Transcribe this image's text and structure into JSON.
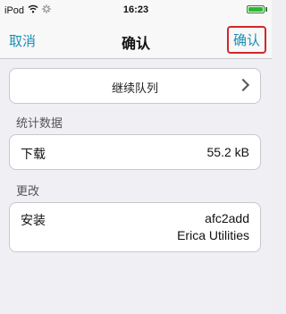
{
  "status_bar": {
    "carrier": "iPod",
    "time": "16:23",
    "wifi_icon": "wifi-icon",
    "activity_icon": "activity-spinner-icon",
    "battery_level": 1.0
  },
  "nav": {
    "cancel_label": "取消",
    "title": "确认",
    "confirm_label": "确认"
  },
  "queue": {
    "label": "继续队列"
  },
  "stats": {
    "header": "统计数据",
    "download_label": "下载",
    "download_value": "55.2 kB"
  },
  "changes": {
    "header": "更改",
    "install_label": "安装",
    "package_name": "afc2add",
    "package_author": "Erica Utilities"
  },
  "colors": {
    "accent": "#1a8fb5",
    "highlight_border": "#d0272d",
    "background": "#efeff4"
  }
}
